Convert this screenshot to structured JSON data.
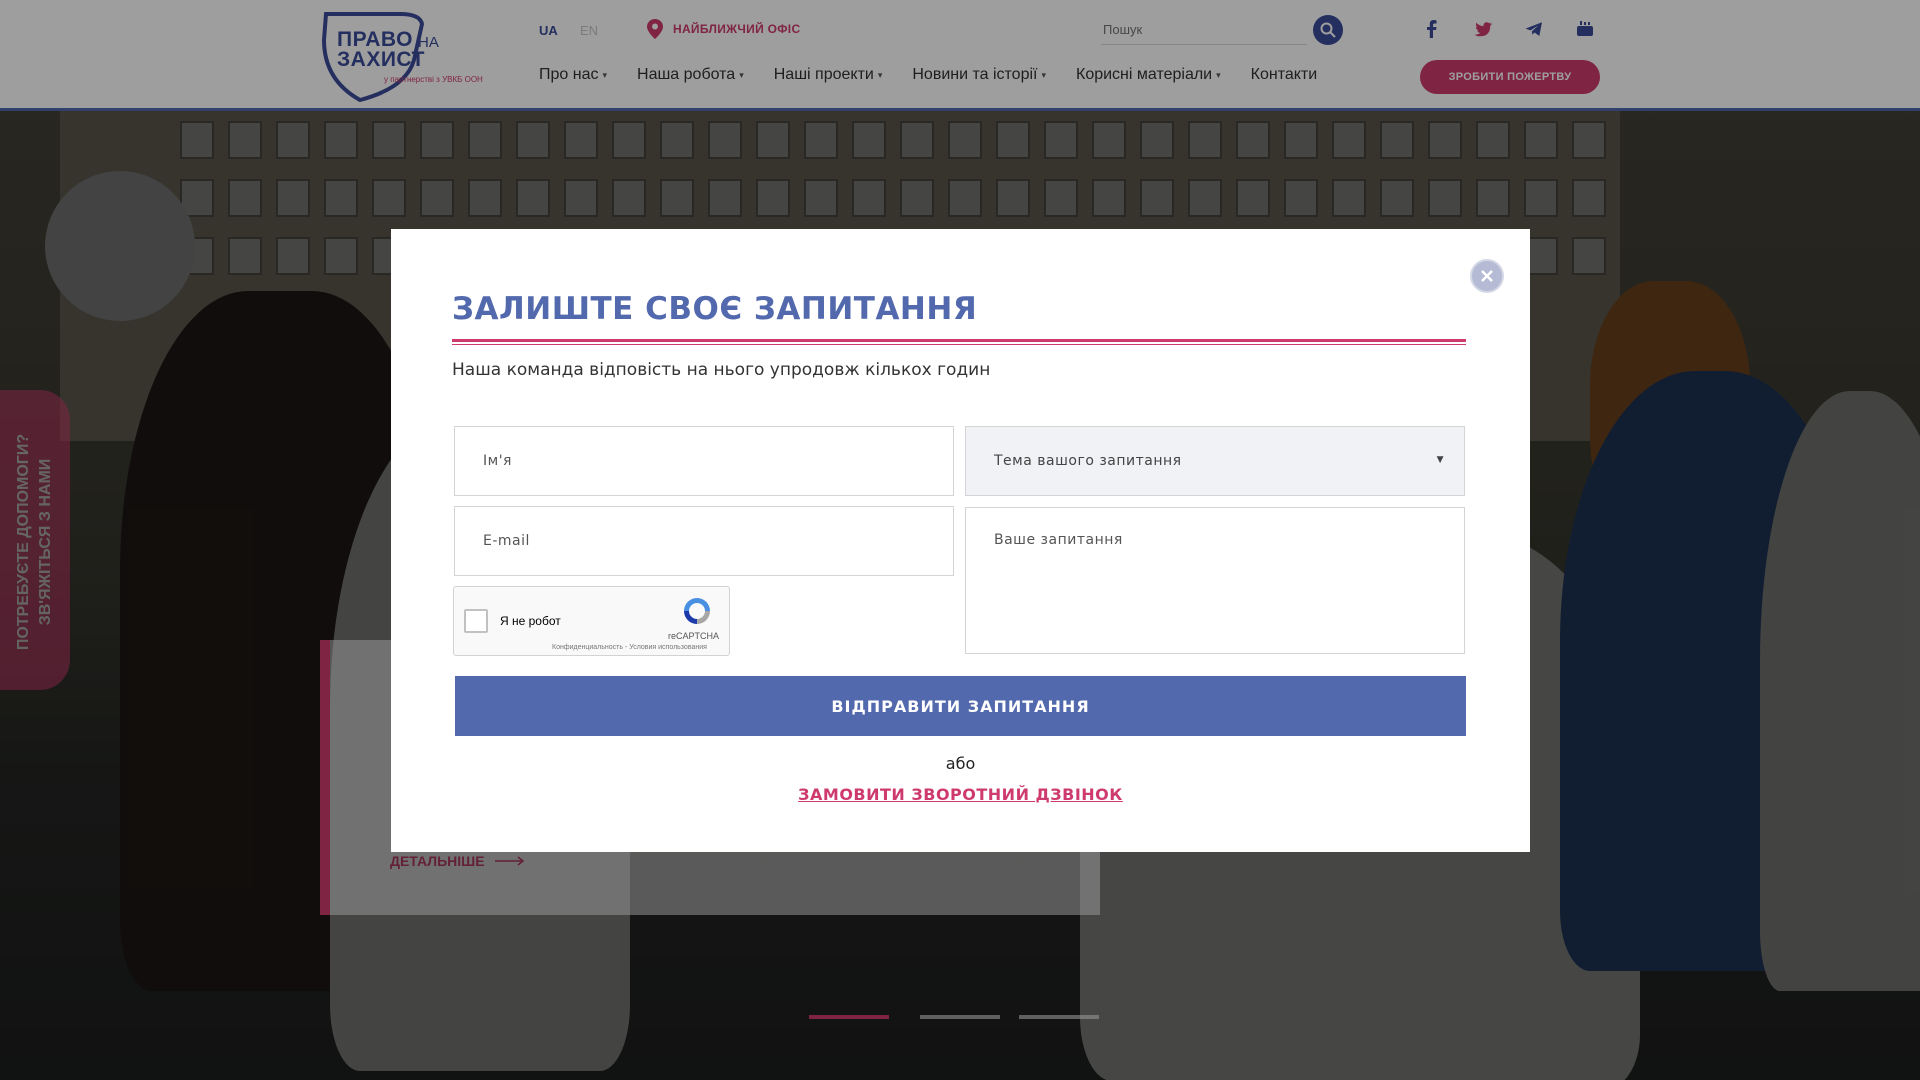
{
  "header": {
    "logo": {
      "line1": "ПРАВО",
      "line2": "ЗАХИСТ",
      "na": "НА",
      "partner": "у партнерстві з УВКБ ООН"
    },
    "languages": [
      "UA",
      "EN"
    ],
    "nearest_office": "НАЙБЛИЖЧИЙ ОФІС",
    "search_placeholder": "Пошук",
    "nav": [
      {
        "label": "Про нас",
        "has_dropdown": true
      },
      {
        "label": "Наша робота",
        "has_dropdown": true
      },
      {
        "label": "Наші проекти",
        "has_dropdown": true
      },
      {
        "label": "Новини та історії",
        "has_dropdown": true
      },
      {
        "label": "Корисні матеріали",
        "has_dropdown": true
      },
      {
        "label": "Контакти",
        "has_dropdown": false
      }
    ],
    "donate_label": "ЗРОБИТИ ПОЖЕРТВУ",
    "social": [
      "facebook-icon",
      "twitter-icon",
      "telegram-icon",
      "youtube-icon"
    ]
  },
  "side_tab": {
    "line1": "ПОТРЕБУЄТЕ ДОПОМОГИ?",
    "line2": "ЗВ'ЯЖІТЬСЯ З НАМИ"
  },
  "slide": {
    "more_label": "ДЕТАЛЬНІШЕ"
  },
  "modal": {
    "title": "ЗАЛИШТЕ СВОЄ ЗАПИТАННЯ",
    "subtitle": "Наша команда відповість на нього упродовж кількох годин",
    "name_placeholder": "Ім'я",
    "email_placeholder": "E-mail",
    "topic_placeholder": "Тема вашого запитання",
    "question_placeholder": "Ваше запитання",
    "captcha": {
      "label": "Я не робот",
      "brand": "reCAPTCHA",
      "privacy": "Конфиденциальность - Условия использования"
    },
    "submit_label": "ВІДПРАВИТИ ЗАПИТАННЯ",
    "or_label": "або",
    "callback_label": "ЗАМОВИТИ ЗВОРОТНИЙ ДЗВІНОК"
  },
  "colors": {
    "brand_blue": "#5269ad",
    "brand_pink": "#cf3a6e"
  }
}
